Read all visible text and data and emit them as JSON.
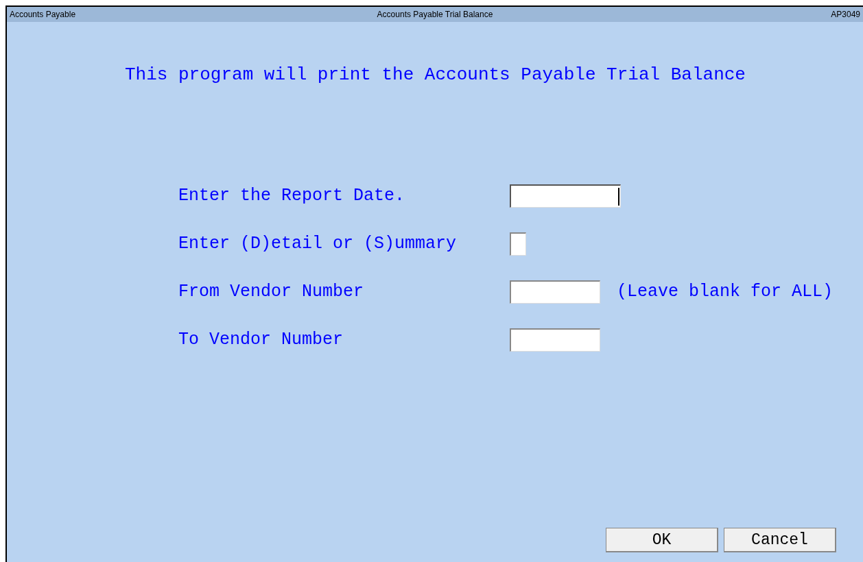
{
  "window": {
    "app": "Accounts Payable",
    "title": "Accounts Payable Trial Balance",
    "code": "AP3049"
  },
  "heading": "This program will print the Accounts Payable Trial Balance",
  "fields": [
    {
      "label": "Enter the Report Date.",
      "kind": "date",
      "focused": true
    },
    {
      "label": "Enter (D)etail or (S)ummary",
      "kind": "code",
      "focused": false
    },
    {
      "label": "From Vendor Number",
      "kind": "vendor",
      "focused": false,
      "hint": "(Leave blank for ALL)"
    },
    {
      "label": "To Vendor Number",
      "kind": "vendor",
      "focused": false
    }
  ],
  "buttons": [
    "OK",
    "Cancel"
  ]
}
